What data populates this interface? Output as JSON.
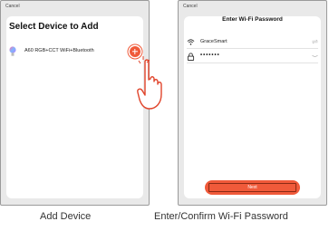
{
  "left_screen": {
    "cancel_label": "Cancel",
    "title": "Select Device to Add",
    "device": {
      "label": "A60 RGB+CCT WiFi+Bluetooth",
      "icon": "light-bulb-icon"
    },
    "add_icon": "plus-icon",
    "pointer_icon": "hand-pointer-icon"
  },
  "right_screen": {
    "cancel_label": "Cancel",
    "title": "Enter Wi-Fi Password",
    "wifi": {
      "icon": "wifi-icon",
      "value": "GraceSmart",
      "suffix_icon": "switch-network-icon"
    },
    "password": {
      "icon": "lock-icon",
      "value": "•••••••",
      "suffix_icon": "eye-hidden-icon"
    },
    "next_label": "Next"
  },
  "captions": {
    "left": "Add Device",
    "right": "Enter/Confirm Wi-Fi Password"
  },
  "colors": {
    "accent": "#f05a3a",
    "frame_bg": "#e9e9e9"
  }
}
